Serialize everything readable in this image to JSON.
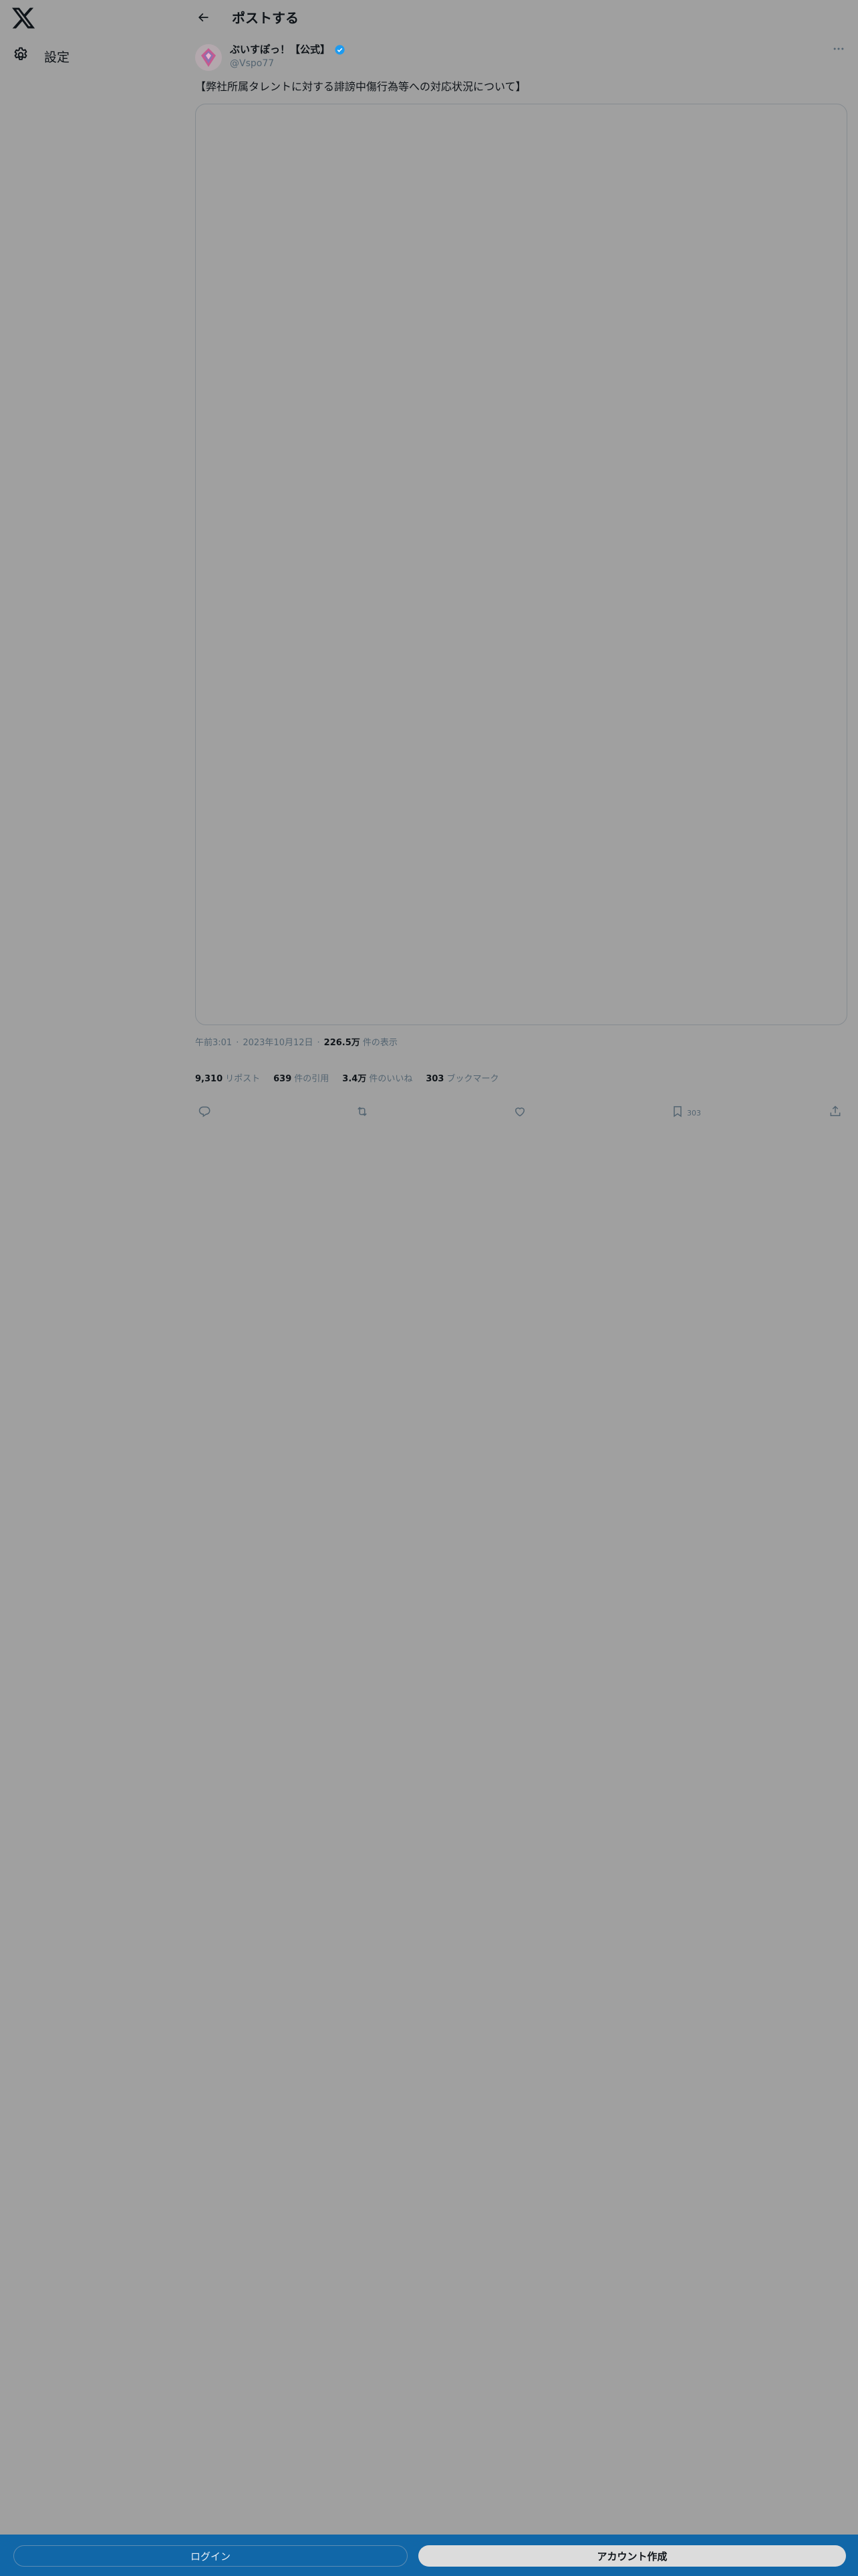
{
  "sidebar": {
    "logo_icon": "x-logo-icon",
    "settings_icon": "gear-icon",
    "settings_label": "設定"
  },
  "header": {
    "back_icon": "arrow-left-icon",
    "title": "ポストする"
  },
  "post": {
    "author_name": "ぶいすぽっ！【公式】",
    "author_handle": "@Vspo77",
    "verified_icon": "verified-badge-icon",
    "text": "【弊社所属タレントに対する誹謗中傷行為等への対応状況について】",
    "time": "午前3:01",
    "date": "2023年10月12日",
    "views_count": "226.5万",
    "views_label": "件の表示",
    "separator": "·"
  },
  "stats": {
    "reposts_count": "9,310",
    "reposts_label": "リポスト",
    "quotes_count": "639",
    "quotes_label": "件の引用",
    "likes_count": "3.4万",
    "likes_label": "件のいいね",
    "bookmarks_count": "303",
    "bookmarks_label": "ブックマーク"
  },
  "actions": {
    "reply_icon": "reply-icon",
    "repost_icon": "repost-icon",
    "like_icon": "heart-icon",
    "bookmark_icon": "bookmark-icon",
    "bookmark_count": "303",
    "share_icon": "share-icon"
  },
  "bottom": {
    "login_label": "ログイン",
    "signup_label": "アカウント作成"
  },
  "colors": {
    "overlay_bg": "#a0a0a0",
    "verified": "#1d9bf0",
    "bottom_bar": "#1167a8"
  }
}
